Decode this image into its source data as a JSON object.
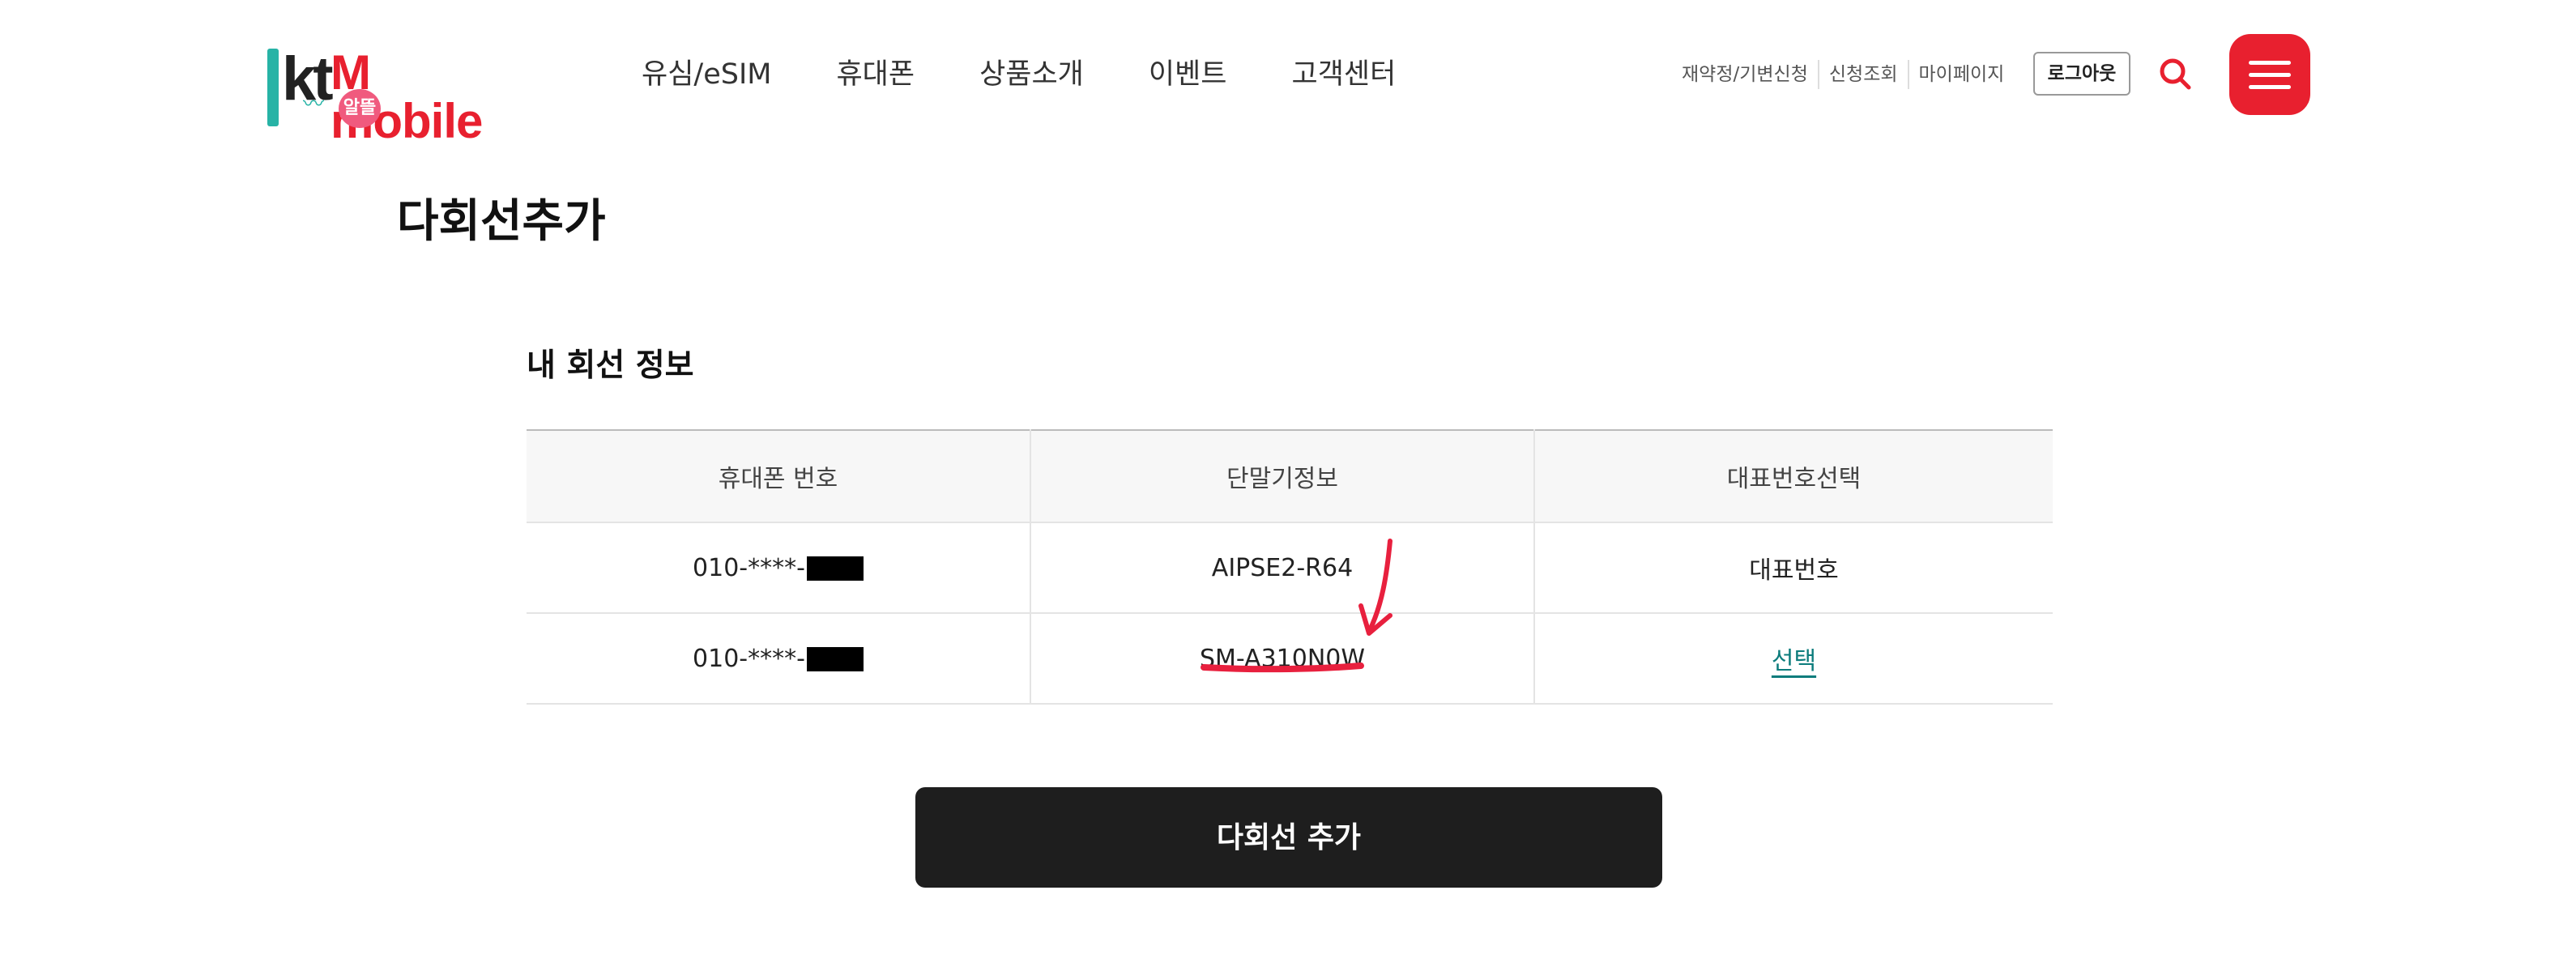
{
  "header": {
    "logo": {
      "kt": "kt",
      "brand": "M mobile",
      "mascot": "알뜰"
    },
    "nav": [
      "유심/eSIM",
      "휴대폰",
      "상품소개",
      "이벤트",
      "고객센터"
    ],
    "util_links": [
      "재약정/기변신청",
      "신청조회",
      "마이페이지"
    ],
    "logout_label": "로그아웃",
    "accent_color": "#e8202f"
  },
  "page": {
    "title": "다회선추가",
    "section_title": "내 회선 정보"
  },
  "table": {
    "headers": [
      "휴대폰 번호",
      "단말기정보",
      "대표번호선택"
    ],
    "rows": [
      {
        "phone": "010-****-",
        "device": "AIPSE2-R64",
        "select": "대표번호"
      },
      {
        "phone": "010-****-",
        "device": "SM-A310N0W",
        "select": "선택"
      }
    ]
  },
  "add_button_label": "다회선 추가"
}
